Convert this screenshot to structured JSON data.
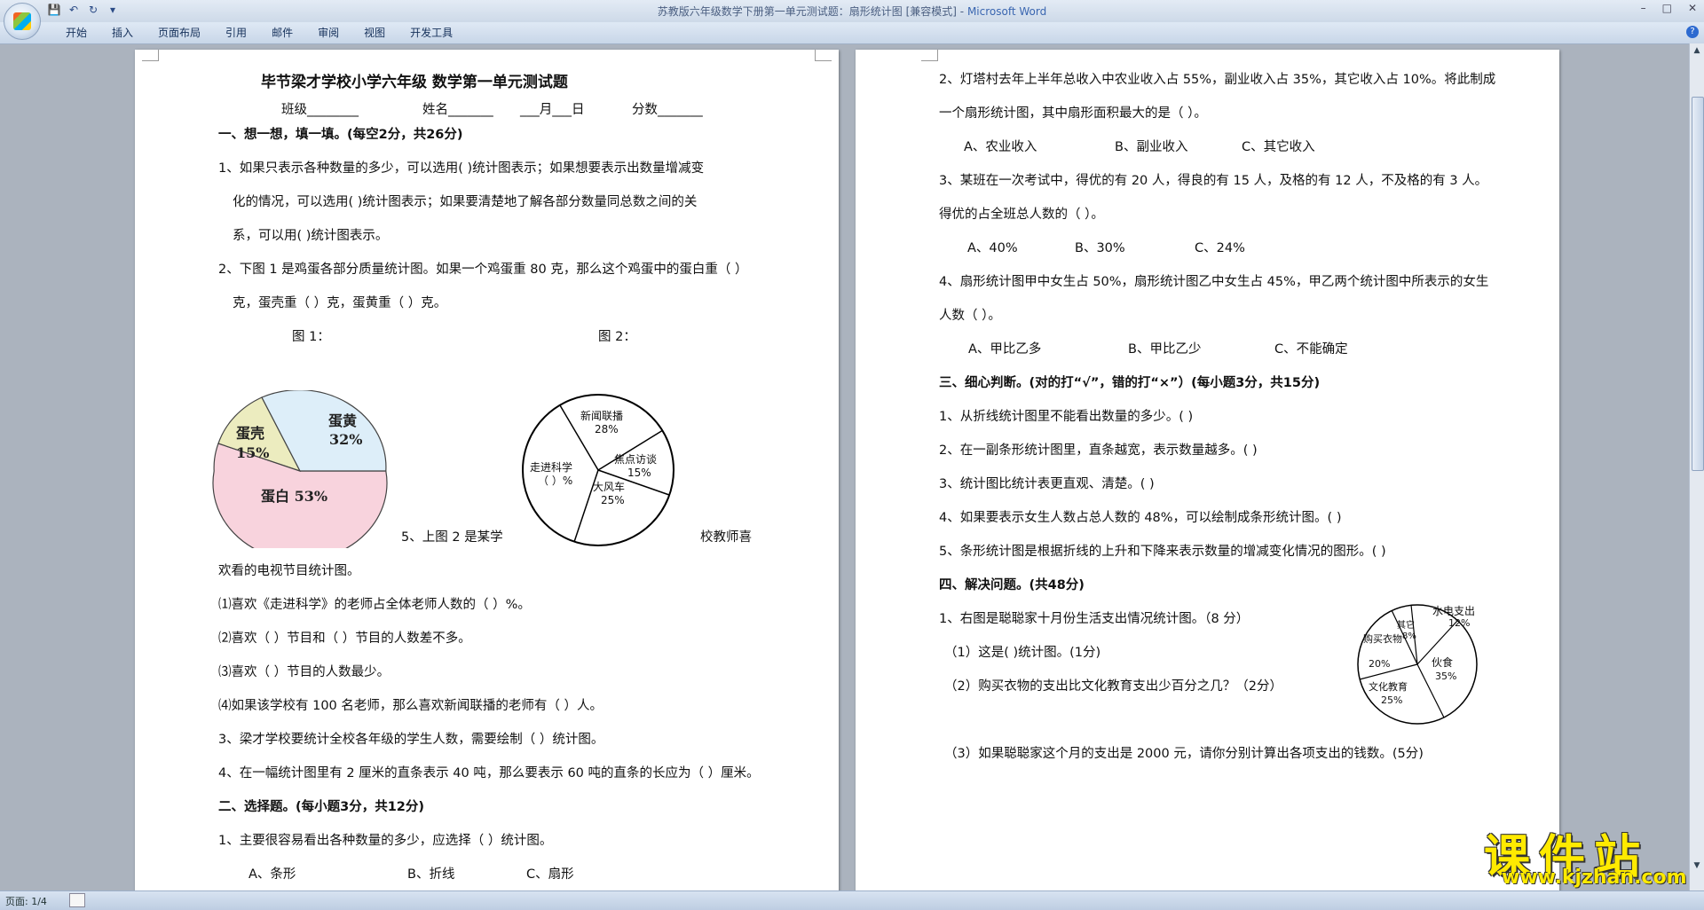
{
  "window": {
    "title": "苏教版六年级数学下册第一单元测试题：扇形统计图 [兼容模式]",
    "app_name": "Microsoft Word",
    "help": "?"
  },
  "ribbon": {
    "tabs": [
      "开始",
      "插入",
      "页面布局",
      "引用",
      "邮件",
      "审阅",
      "视图",
      "开发工具"
    ]
  },
  "page1": {
    "title": "毕节梁才学校小学六年级 数学第一单元测试题",
    "info": [
      "班级________",
      "姓名_______",
      "___月___日",
      "分数_______"
    ],
    "lines": [
      "一、想一想，填一填。(每空2分，共26分)",
      "1、如果只表示各种数量的多少，可以选用(          )统计图表示；如果想要表示出数量增减变",
      "化的情况，可以选用(          )统计图表示；如果要清楚地了解各部分数量同总数之间的关",
      "系，可以用(          )统计图表示。",
      "2、下图 1 是鸡蛋各部分质量统计图。如果一个鸡蛋重 80 克，那么这个鸡蛋中的蛋白重（    ）",
      "克，蛋壳重（    ）克，蛋黄重（    ）克。",
      "图 1：",
      "图 2：",
      "5、上图 2 是某学",
      "校教师喜",
      "欢看的电视节目统计图。",
      "⑴喜欢《走进科学》的老师占全体老师人数的（    ）%。",
      "⑵喜欢（      ）节目和（      ）节目的人数差不多。",
      "⑶喜欢（        ）节目的人数最少。",
      "⑷如果该学校有 100 名老师，那么喜欢新闻联播的老师有（    ）人。",
      "3、梁才学校要统计全校各年级的学生人数，需要绘制（    ）统计图。",
      "4、在一幅统计图里有 2 厘米的直条表示 40 吨，那么要表示 60 吨的直条的长应为（    ）厘米。",
      "二、选择题。(每小题3分，共12分)",
      "1、主要很容易看出各种数量的多少，应选择（        ）统计图。",
      "A、条形",
      "B、折线",
      "C、扇形"
    ],
    "figure1": {
      "slices": [
        {
          "label": "蛋黄",
          "value": "32%"
        },
        {
          "label": "蛋壳",
          "value": "15%"
        },
        {
          "label": "蛋白 53%"
        }
      ]
    },
    "figure2": {
      "slices": [
        {
          "label": "新闻联播",
          "value": "28%"
        },
        {
          "label": "焦点访谈",
          "value": "15%"
        },
        {
          "label": "大风车",
          "value": "25%"
        },
        {
          "label": "走进科学",
          "value": "（    ）%"
        }
      ]
    }
  },
  "page2": {
    "lines": [
      "2、灯塔村去年上半年总收入中农业收入占 55%，副业收入占 35%，其它收入占 10%。将此制成",
      "一个扇形统计图，其中扇形面积最大的是（          ）。",
      "A、农业收入",
      "B、副业收入",
      "C、其它收入",
      "3、某班在一次考试中，得优的有 20 人，得良的有 15 人，及格的有 12 人，不及格的有 3 人。",
      "得优的占全班总人数的（          ）。",
      "A、40%",
      "B、30%",
      "C、24%",
      "4、扇形统计图甲中女生占 50%，扇形统计图乙中女生占 45%，甲乙两个统计图中所表示的女生",
      "人数（          ）。",
      "A、甲比乙多",
      "B、甲比乙少",
      "C、不能确定",
      "三、细心判断。(对的打“√”，错的打“×”）(每小题3分，共15分)",
      "1、从折线统计图里不能看出数量的多少。(          )",
      "2、在一副条形统计图里，直条越宽，表示数量越多。(          )",
      "3、统计图比统计表更直观、清楚。(          )",
      "4、如果要表示女生人数占总人数的 48%，可以绘制成条形统计图。(          )",
      "5、条形统计图是根据折线的上升和下降来表示数量的增减变化情况的图形。(          )",
      "四、解决问题。(共48分)",
      "1、右图是聪聪家十月份生活支出情况统计图。（8 分）",
      "（1）这是(          )统计图。(1分)",
      "（2）购买衣物的支出比文化教育支出少百分之几？（2分）",
      "（3）如果聪聪家这个月的支出是 2000 元，请你分别计算出各项支出的钱数。(5分)"
    ],
    "figure3": {
      "slices": [
        {
          "label": "水电支出",
          "value": "12%"
        },
        {
          "label": "其它",
          "value": "8%"
        },
        {
          "label": "购买衣物",
          "value": "20%"
        },
        {
          "label": "伙食",
          "value": "35%"
        },
        {
          "label": "文化教育",
          "value": "25%"
        }
      ]
    }
  },
  "status": {
    "page_label": "页面: 1/4"
  },
  "watermark": {
    "main": "课件站",
    "url": "www.kjzhan.com"
  }
}
